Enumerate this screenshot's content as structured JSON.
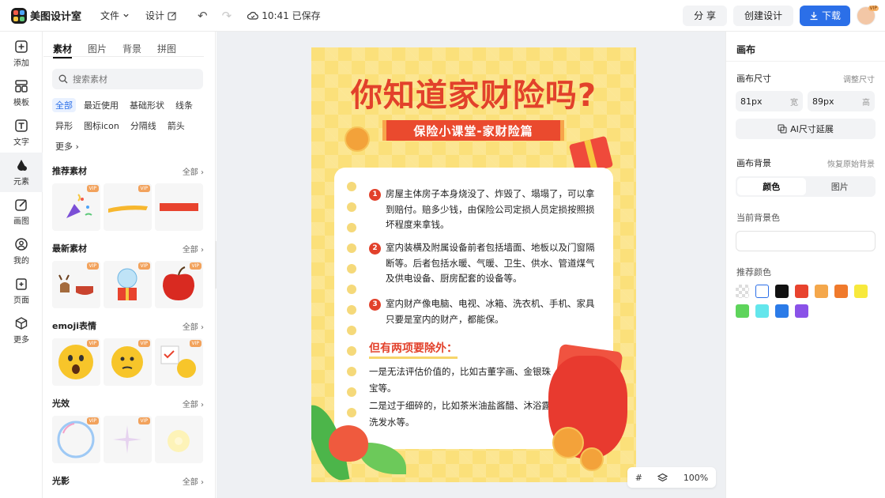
{
  "app": {
    "name": "美图设计室"
  },
  "menu": {
    "file": "文件",
    "design": "设计"
  },
  "save_status": "10:41 已保存",
  "actions": {
    "share": "分 享",
    "create": "创建设计",
    "download": "下载"
  },
  "avatar_badge": "VIP",
  "leftnav": [
    {
      "label": "添加",
      "icon": "plus-square-icon"
    },
    {
      "label": "模板",
      "icon": "template-icon"
    },
    {
      "label": "文字",
      "icon": "text-icon"
    },
    {
      "label": "元素",
      "icon": "elements-icon"
    },
    {
      "label": "画图",
      "icon": "draw-icon"
    },
    {
      "label": "我的",
      "icon": "user-icon"
    },
    {
      "label": "页面",
      "icon": "page-add-icon"
    },
    {
      "label": "更多",
      "icon": "cube-icon"
    }
  ],
  "panel": {
    "tabs": [
      "素材",
      "图片",
      "背景",
      "拼图"
    ],
    "search_placeholder": "搜索素材",
    "chips": [
      "全部",
      "最近使用",
      "基础形状",
      "线条",
      "异形",
      "图标icon",
      "分隔线",
      "箭头",
      "更多"
    ],
    "all_label": "全部",
    "vip": "VIP",
    "sections": [
      {
        "title": "推荐素材"
      },
      {
        "title": "最新素材"
      },
      {
        "title": "emoji表情"
      },
      {
        "title": "光效"
      },
      {
        "title": "光影"
      }
    ]
  },
  "poster": {
    "title": "你知道家财险吗?",
    "subtitle": "保险小课堂-家财险篇",
    "items": [
      {
        "num": "1",
        "text": "房屋主体房子本身烧没了、炸毁了、塌塌了，可以拿到赔付。赔多少钱，由保险公司定损人员定损按照损坏程度来拿钱。"
      },
      {
        "num": "2",
        "text": "室内装横及附属设备前者包括墙面、地板以及门窗隔断等。后者包括水暖、气暖、卫生、供水、管道煤气及供电设备、厨房配套的设备等。"
      },
      {
        "num": "3",
        "text": "室内财产像电脑、电视、冰箱、洗衣机、手机、家具只要是室内的财产，都能保。"
      }
    ],
    "exclude_title": "但有两项要除外：",
    "exclude_lines": [
      "一是无法评估价值的，比如古董字画、金银珠宝等。",
      "二是过于细碎的，比如茶米油盐酱醋、沐浴露洗发水等。"
    ]
  },
  "canvas_toolbar": {
    "zoom": "100%"
  },
  "right": {
    "title": "画布",
    "size_label": "画布尺寸",
    "adjust_size": "调整尺寸",
    "width_value": "81px",
    "width_unit": "宽",
    "height_value": "89px",
    "height_unit": "高",
    "ai_extend": "AI尺寸延展",
    "bg_label": "画布背景",
    "restore_bg": "恢复原始背景",
    "seg_color": "颜色",
    "seg_image": "图片",
    "current_bg": "当前背景色",
    "recommend": "推荐颜色",
    "swatches": [
      "transparent",
      "#ffffff",
      "#111111",
      "#e8432e",
      "#f4a74b",
      "#f07a2c",
      "#f7e93c",
      "#5ed45b",
      "#63e6ec",
      "#2b7be8",
      "#8a52e8"
    ]
  }
}
